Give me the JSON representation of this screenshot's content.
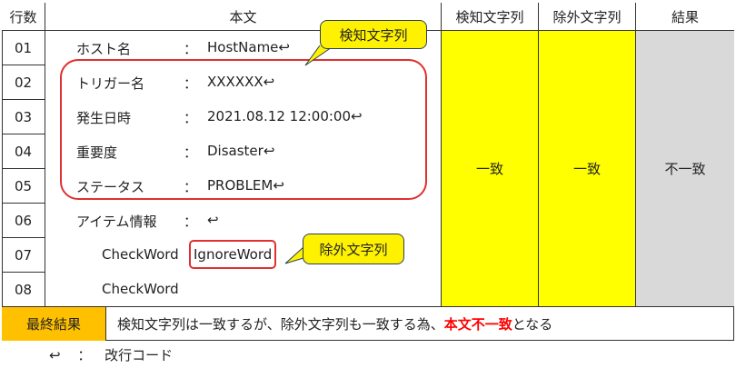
{
  "header": {
    "line_no": "行数",
    "body": "本文",
    "detect": "検知文字列",
    "exclude": "除外文字列",
    "result": "結果"
  },
  "rows": [
    {
      "no": "01",
      "key": "ホスト名",
      "colon": "：",
      "value": "HostName"
    },
    {
      "no": "02",
      "key": "トリガー名",
      "colon": "：",
      "value": "XXXXXX"
    },
    {
      "no": "03",
      "key": "発生日時",
      "colon": "：",
      "value": "2021.08.12 12:00:00"
    },
    {
      "no": "04",
      "key": "重要度",
      "colon": "：",
      "value": "Disaster"
    },
    {
      "no": "05",
      "key": "ステータス",
      "colon": "：",
      "value": "PROBLEM"
    },
    {
      "no": "06",
      "key": "アイテム情報",
      "colon": "：",
      "value": ""
    },
    {
      "no": "07",
      "key": "CheckWord",
      "colon": "",
      "value": "IgnoreWord"
    },
    {
      "no": "08",
      "key": "CheckWord",
      "colon": "",
      "value": ""
    }
  ],
  "return_mark": "↩",
  "detect_result": "一致",
  "exclude_result": "一致",
  "final_result": "不一致",
  "callouts": {
    "detect": "検知文字列",
    "exclude": "除外文字列"
  },
  "final": {
    "label": "最終結果",
    "text_before": "検知文字列は一致するが、除外文字列も一致する為、",
    "text_emph": "本文不一致",
    "text_after": "となる"
  },
  "legend": {
    "mark": "↩",
    "colon": "：",
    "text": "改行コード"
  },
  "colors": {
    "highlight_yellow": "#ffff00",
    "result_gray": "#d9d9d9",
    "final_label_orange": "#ffc000",
    "emphasis_red": "#ff0000",
    "box_red": "#e03030"
  }
}
